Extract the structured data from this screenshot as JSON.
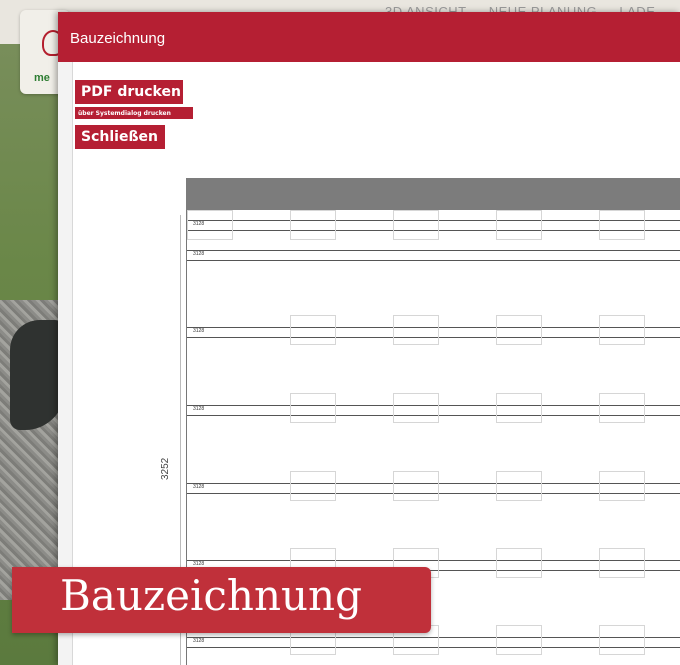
{
  "background": {
    "nav_items": [
      "3D ANSICHT",
      "NEUE PLANUNG",
      "LADE"
    ],
    "logo_text": "me"
  },
  "dialog": {
    "title": "Bauzeichnung",
    "buttons": {
      "pdf_print": "PDF drucken",
      "system_print": "über Systemdialog drucken",
      "close": "Schließen"
    }
  },
  "drawing": {
    "dimension_label": "3252",
    "row_labels": [
      "3128",
      "3128",
      "3128",
      "3128",
      "3128",
      "3128",
      "3128"
    ]
  },
  "caption": {
    "text": "Bauzeichnung"
  },
  "colors": {
    "brand_red": "#b51f33",
    "caption_red": "#c0303a",
    "drawing_header_gray": "#7c7c7c"
  }
}
